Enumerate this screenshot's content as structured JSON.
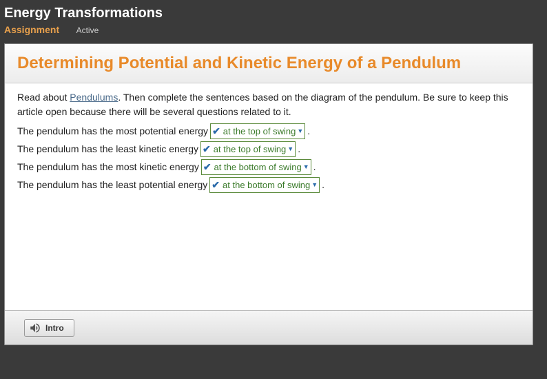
{
  "header": {
    "title": "Energy Transformations",
    "assignment_label": "Assignment",
    "status": "Active"
  },
  "question": {
    "title": "Determining Potential and Kinetic Energy of a Pendulum",
    "intro_prefix": "Read about ",
    "link_text": "Pendulums",
    "intro_suffix": ". Then complete the sentences based on the diagram of the pendulum. Be sure to keep this article open because there will be several questions related to it.",
    "sentences": [
      {
        "before": "The pendulum has the most potential energy ",
        "answer": "at the top of swing",
        "after": " ."
      },
      {
        "before": "The pendulum has the least kinetic energy ",
        "answer": "at the top of swing",
        "after": " ."
      },
      {
        "before": "The pendulum has the most kinetic energy ",
        "answer": "at the bottom of swing",
        "after": " ."
      },
      {
        "before": "The pendulum has the least potential energy ",
        "answer": "at the bottom of swing",
        "after": " ."
      }
    ]
  },
  "footer": {
    "intro_button": "Intro"
  }
}
